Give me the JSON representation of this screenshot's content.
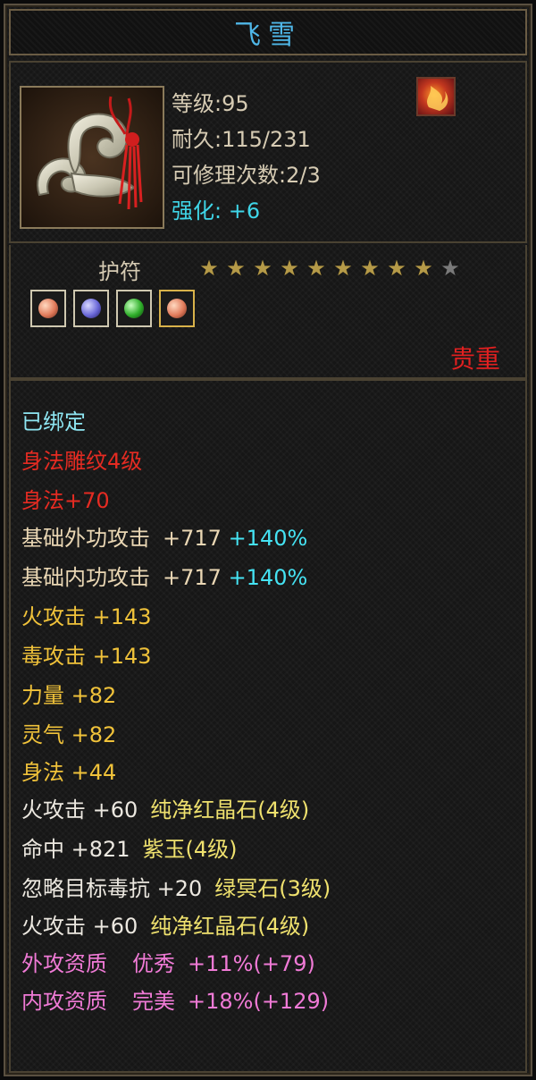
{
  "item": {
    "name": "飞雪",
    "level_line": "等级:95",
    "durability_line": "耐久:115/231",
    "repair_line": "可修理次数:2/3",
    "enhance_line": "强化: +6",
    "type": "护符",
    "stars_filled": 9,
    "stars_total": 10,
    "rarity": "贵重",
    "gem_sockets": [
      {
        "icon": "pink-gem-icon",
        "color": "#e8a07a"
      },
      {
        "icon": "blue-gem-icon",
        "color": "#7a78e0"
      },
      {
        "icon": "green-gem-icon",
        "color": "#3fbe3a"
      },
      {
        "icon": "pink-gem-icon",
        "color": "#e8a07a"
      }
    ]
  },
  "stats": {
    "bound": "已绑定",
    "engrave": "身法雕纹4级",
    "engrave_bonus": "身法+70",
    "outer_attack": {
      "label": "基础外功攻击",
      "value": "+717",
      "percent": "+140%"
    },
    "inner_attack": {
      "label": "基础内功攻击",
      "value": "+717",
      "percent": "+140%"
    },
    "fire_attack": "火攻击 +143",
    "poison_attack": "毒攻击 +143",
    "strength": "力量 +82",
    "spirit": "灵气 +82",
    "agility": "身法 +44",
    "gem1": {
      "stat": "火攻击 +60",
      "gem": "纯净红晶石(4级)"
    },
    "gem2": {
      "stat": "命中 +821",
      "gem": "紫玉(4级)"
    },
    "gem3": {
      "stat": "忽略目标毒抗 +20",
      "gem": "绿冥石(3级)"
    },
    "gem4": {
      "stat": "火攻击 +60",
      "gem": "纯净红晶石(4级)"
    },
    "outer_quality": {
      "label": "外攻资质",
      "grade": "优秀",
      "value": "+11%(+79)"
    },
    "inner_quality": {
      "label": "内攻资质",
      "grade": "完美",
      "value": "+18%(+129)"
    }
  }
}
